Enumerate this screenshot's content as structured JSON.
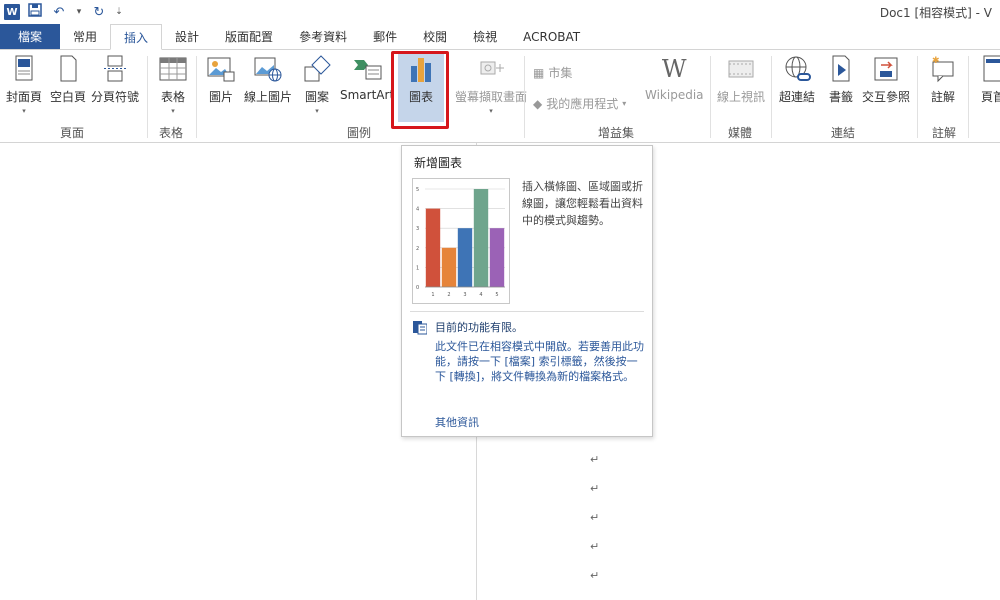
{
  "titlebar": {
    "app_badge": "W",
    "doc_title": "Doc1 [相容模式] - V"
  },
  "tabs": [
    {
      "label": "檔案"
    },
    {
      "label": "常用"
    },
    {
      "label": "插入"
    },
    {
      "label": "設計"
    },
    {
      "label": "版面配置"
    },
    {
      "label": "參考資料"
    },
    {
      "label": "郵件"
    },
    {
      "label": "校閱"
    },
    {
      "label": "檢視"
    },
    {
      "label": "ACROBAT"
    }
  ],
  "ribbon": {
    "buttons": {
      "cover": "封面頁",
      "blank": "空白頁",
      "pagebreak": "分頁符號",
      "table": "表格",
      "picture": "圖片",
      "online_picture": "線上圖片",
      "shapes": "圖案",
      "smartart": "SmartArt",
      "chart": "圖表",
      "screenshot": "螢幕擷取畫面",
      "store": "市集",
      "myapps": "我的應用程式",
      "wikipedia": "Wikipedia",
      "online_video": "線上視訊",
      "hyperlink": "超連結",
      "bookmark": "書籤",
      "crossref": "交互參照",
      "comment": "註解",
      "header": "頁首"
    },
    "groups": {
      "pages": "頁面",
      "tables": "表格",
      "illustrations": "圖例",
      "addins": "增益集",
      "media": "媒體",
      "links": "連結",
      "comments": "註解"
    }
  },
  "tooltip": {
    "title": "新增圖表",
    "description": "插入橫條圖、區域圖或折線圖，讓您輕鬆看出資料中的模式與趨勢。",
    "warning_title": "目前的功能有限。",
    "warning_body": "此文件已在相容模式中開啟。若要善用此功能，請按一下 [檔案] 索引標籤，然後按一下 [轉換]，將文件轉換為新的檔案格式。",
    "more_info": "其他資訊"
  },
  "doc": {
    "para_mark": "↵"
  },
  "chart_data": {
    "type": "bar",
    "categories": [
      "1",
      "2",
      "3",
      "4",
      "5"
    ],
    "values": [
      4,
      2,
      3,
      5,
      3
    ],
    "colors": [
      "#d0513b",
      "#e6843a",
      "#3e74b6",
      "#6fa58d",
      "#9b62b6"
    ],
    "yticks": [
      "0",
      "1",
      "2",
      "3",
      "4",
      "5"
    ],
    "ylim": [
      0,
      5
    ]
  },
  "colors": {
    "accent": "#2b579a",
    "highlight_border": "#d6161b"
  }
}
